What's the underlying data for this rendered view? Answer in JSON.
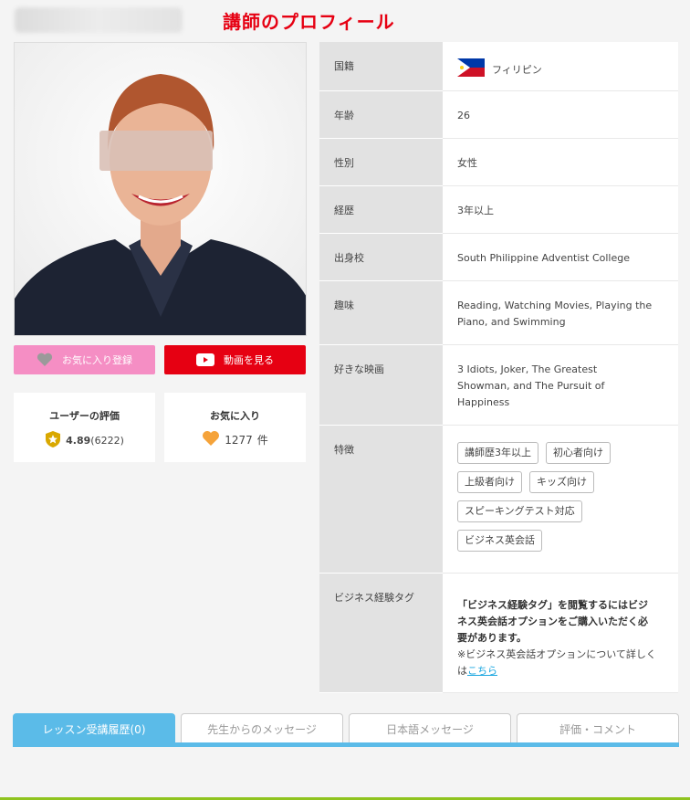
{
  "header": {
    "title": "講師のプロフィール"
  },
  "buttons": {
    "favorite": "お気に入り登録",
    "video": "動画を見る"
  },
  "rating": {
    "title": "ユーザーの評価",
    "score": "4.89",
    "count": "(6222)"
  },
  "favorites": {
    "title": "お気に入り",
    "count": "1277",
    "unit": "件"
  },
  "profile": {
    "nationality_label": "国籍",
    "nationality": "フィリピン",
    "age_label": "年齢",
    "age": "26",
    "gender_label": "性別",
    "gender": "女性",
    "career_label": "経歴",
    "career": "3年以上",
    "school_label": "出身校",
    "school": "South Philippine Adventist College",
    "hobby_label": "趣味",
    "hobby": "Reading, Watching Movies, Playing the Piano, and Swimming",
    "movies_label": "好きな映画",
    "movies": "3 Idiots, Joker, The Greatest Showman, and The Pursuit of Happiness",
    "features_label": "特徴",
    "features": [
      "講師歴3年以上",
      "初心者向け",
      "上級者向け",
      "キッズ向け",
      "スピーキングテスト対応",
      "ビジネス英会話"
    ],
    "biz_label": "ビジネス経験タグ",
    "biz_notice": "「ビジネス経験タグ」を閲覧するにはビジネス英会話オプションをご購入いただく必要があります。",
    "biz_note": "※ビジネス英会話オプションについて詳しくは",
    "biz_link": "こちら"
  },
  "tabs": [
    "レッスン受講履歴(0)",
    "先生からのメッセージ",
    "日本語メッセージ",
    "評価・コメント"
  ],
  "colors": {
    "accent_red": "#e60012",
    "pink": "#f58ec4",
    "tab_blue": "#5bbbe8",
    "link": "#1ca7e0"
  }
}
